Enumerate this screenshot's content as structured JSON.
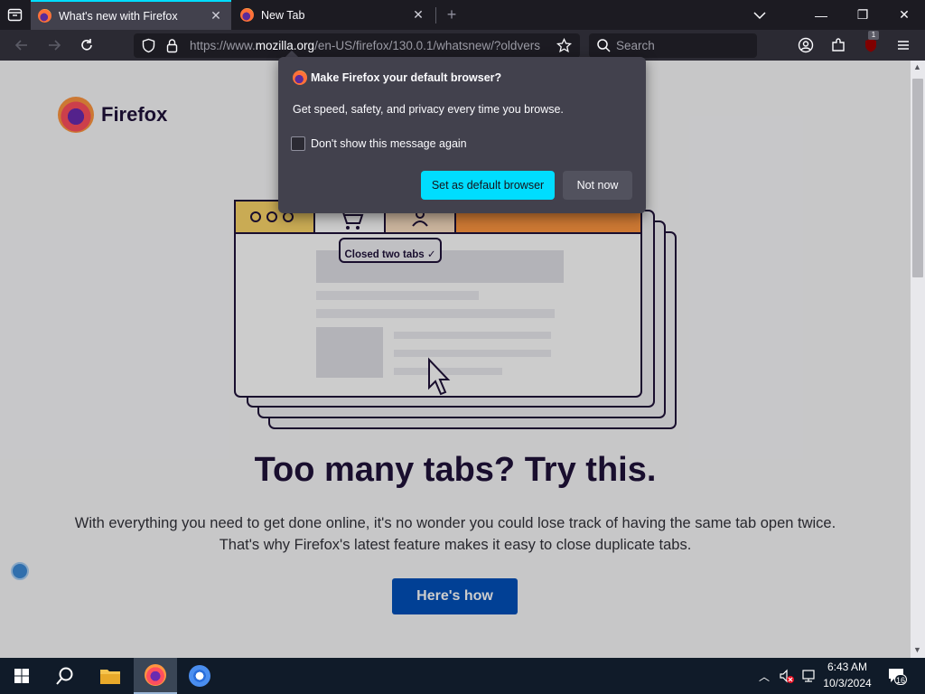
{
  "tabs": [
    {
      "title": "What's new with Firefox",
      "active": true
    },
    {
      "title": "New Tab",
      "active": false
    }
  ],
  "tabstrip": {
    "new_tab": "+"
  },
  "window_controls": {
    "minimize": "—",
    "restore": "❐",
    "close": "✕"
  },
  "urlbar": {
    "url_prefix": "https://www.",
    "url_host": "mozilla.org",
    "url_path": "/en-US/firefox/130.0.1/whatsnew/?oldvers"
  },
  "searchbar": {
    "placeholder": "Search"
  },
  "toolbar": {
    "extension_badge": "1"
  },
  "page": {
    "brand": "Firefox",
    "illustration_label": "Closed two tabs ✓",
    "headline": "Too many tabs? Try this.",
    "body_line1": "With everything you need to get done online, it's no wonder you could lose track of having the same tab open twice.",
    "body_line2": "That's why Firefox's latest feature makes it easy to close duplicate tabs.",
    "cta": "Here's how"
  },
  "popup": {
    "title": "Make Firefox your default browser?",
    "description": "Get speed, safety, and privacy every time you browse.",
    "checkbox_label": "Don't show this message again",
    "checkbox_checked": false,
    "primary_button": "Set as default browser",
    "secondary_button": "Not now"
  },
  "taskbar": {
    "time": "6:43 AM",
    "date": "10/3/2024",
    "notification_count": "16"
  },
  "colors": {
    "accent": "#00ddff",
    "cta": "#0250bb",
    "headline": "#20123a"
  }
}
